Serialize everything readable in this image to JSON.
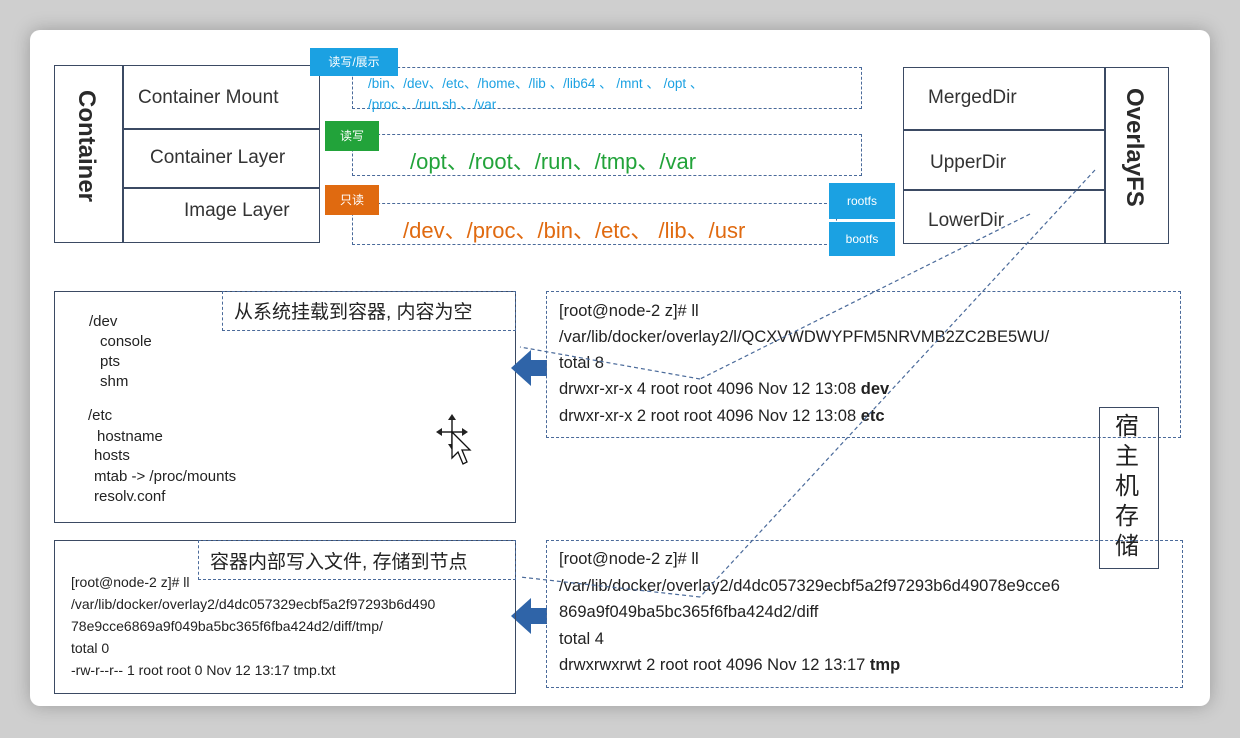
{
  "container": {
    "title": "Container",
    "layers": [
      "Container Mount",
      "Container Layer",
      "Image Layer"
    ]
  },
  "tags": {
    "mount": "读写/展示",
    "rw": "读写",
    "ro": "只读",
    "rootfs": "rootfs",
    "bootfs": "bootfs"
  },
  "paths": {
    "mount_line1": "/bin、/dev、/etc、/home、/lib 、/lib64 、 /mnt 、 /opt 、",
    "mount_line2": "/proc 、/run.sh 、/var",
    "rw": "/opt、/root、/run、/tmp、/var",
    "ro": "/dev、/proc、/bin、/etc、 /lib、/usr"
  },
  "overlay": {
    "title": "OverlayFS",
    "dirs": [
      "MergedDir",
      "UpperDir",
      "LowerDir"
    ]
  },
  "top_left": {
    "caption": "从系统挂载到容器, 内容为空",
    "lines": [
      "/dev",
      "console",
      "pts",
      "shm",
      "/etc",
      "hostname",
      "hosts",
      "mtab -> /proc/mounts",
      "resolv.conf"
    ]
  },
  "top_right": {
    "line1": "[root@node-2 z]# ll",
    "line2": "/var/lib/docker/overlay2/l/QCXVWDWYPFM5NRVMB2ZC2BE5WU/",
    "line3": "total 8",
    "line4_prefix": "drwxr-xr-x 4 root root 4096 Nov 12 13:08 ",
    "line4_bold": "dev",
    "line5_prefix": "drwxr-xr-x 2 root root 4096 Nov 12 13:08 ",
    "line5_bold": "etc"
  },
  "host_label": "宿主机存储",
  "bottom_left": {
    "caption": "容器内部写入文件, 存储到节点",
    "lines": [
      "[root@node-2 z]# ll",
      "/var/lib/docker/overlay2/d4dc057329ecbf5a2f97293b6d490",
      "78e9cce6869a9f049ba5bc365f6fba424d2/diff/tmp/",
      "total 0",
      "-rw-r--r-- 1 root root 0 Nov 12 13:17 tmp.txt"
    ]
  },
  "bottom_right": {
    "line1": "[root@node-2 z]# ll",
    "line2": "/var/lib/docker/overlay2/d4dc057329ecbf5a2f97293b6d49078e9cce6",
    "line3": "869a9f049ba5bc365f6fba424d2/diff",
    "line4": "total 4",
    "line5_prefix": "drwxrwxrwt 2 root root 4096 Nov 12 13:17 ",
    "line5_bold": "tmp"
  },
  "colors": {
    "mount_blue": "#1ba1e2",
    "rw_green": "#22a33a",
    "ro_orange": "#e06a10",
    "arrow_blue": "#2f64a8"
  },
  "icons": [
    "move-cursor-icon"
  ]
}
